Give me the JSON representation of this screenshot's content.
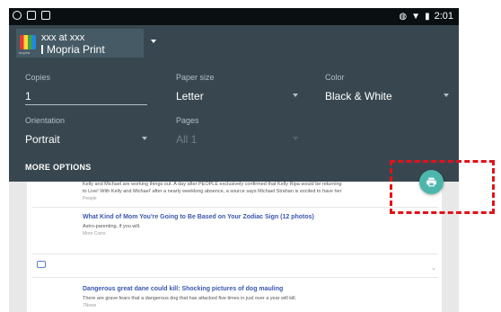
{
  "status_bar": {
    "time": "2:01",
    "left_icons": [
      "notification-icon",
      "screenshot-icon",
      "sim-icon"
    ],
    "right_icons": [
      "vibrate-icon",
      "wifi-icon",
      "battery-icon"
    ]
  },
  "printer": {
    "line1": "xxx at xxx",
    "line2": "Mopria Print",
    "logo_text": "mopria"
  },
  "options": {
    "copies": {
      "label": "Copies",
      "value": "1"
    },
    "paper_size": {
      "label": "Paper size",
      "value": "Letter"
    },
    "color": {
      "label": "Color",
      "value": "Black & White"
    },
    "orientation": {
      "label": "Orientation",
      "value": "Portrait"
    },
    "pages": {
      "label": "Pages",
      "value": "All 1"
    },
    "more_options": "MORE OPTIONS"
  },
  "preview": {
    "story1_line1": "Kelly and Michael are working things out. A day after PEOPLE exclusively confirmed that Kelly Ripa would be returning",
    "story1_line2": "to Live! With Kelly and Michael' after a nearly weeklong absence, a source says Michael Strahan is excited to have her",
    "story1_tag": "People",
    "story2_title": "What Kind of Mom You're Going to Be Based on Your Zodiac Sign",
    "story2_count": "(12 photos)",
    "story2_sub": "Astro-parenting, if you will.",
    "story2_tag": "More Coins",
    "story3_title": "Dangerous great dane could kill: Shocking pictures of dog mauling",
    "story3_sub": "There are grave fears that a dangerous dog that has attacked five times in just over a year will kill.",
    "story3_tag": "7News"
  },
  "fab": {
    "icon": "print-icon"
  },
  "colors": {
    "panel": "#38474f",
    "fab": "#4db6ac",
    "highlight": "#e0121a",
    "headline": "#3b57b4"
  }
}
